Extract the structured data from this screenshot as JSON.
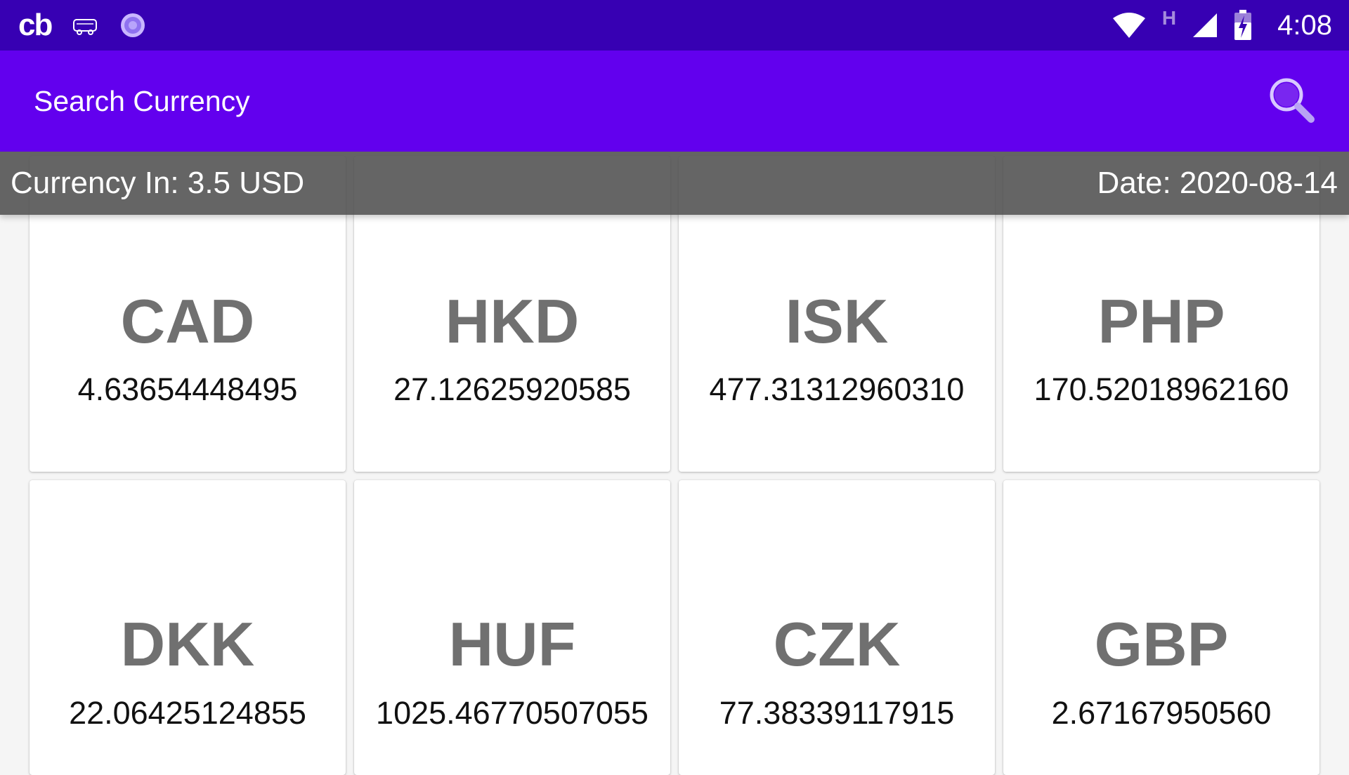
{
  "status_bar": {
    "app_logo_text": "cb",
    "network_label": "H",
    "time": "4:08",
    "icons": [
      "bus-icon",
      "spinner-icon",
      "wifi-icon",
      "cell-signal-icon",
      "battery-charging-icon"
    ]
  },
  "app_bar": {
    "title": "Search Currency",
    "search_icon": "search-icon"
  },
  "info_bar": {
    "currency_in": "Currency In: 3.5 USD",
    "date": "Date: 2020-08-14"
  },
  "currencies": [
    {
      "code": "CAD",
      "value": "4.63654448495"
    },
    {
      "code": "HKD",
      "value": "27.12625920585"
    },
    {
      "code": "ISK",
      "value": "477.31312960310"
    },
    {
      "code": "PHP",
      "value": "170.52018962160"
    },
    {
      "code": "DKK",
      "value": "22.06425124855"
    },
    {
      "code": "HUF",
      "value": "1025.46770507055"
    },
    {
      "code": "CZK",
      "value": "77.38339117915"
    },
    {
      "code": "GBP",
      "value": "2.67167950560"
    }
  ],
  "colors": {
    "status_bar": "#3700b3",
    "app_bar": "#6200ee",
    "code_text": "#707070",
    "info_bar": "#505050"
  }
}
